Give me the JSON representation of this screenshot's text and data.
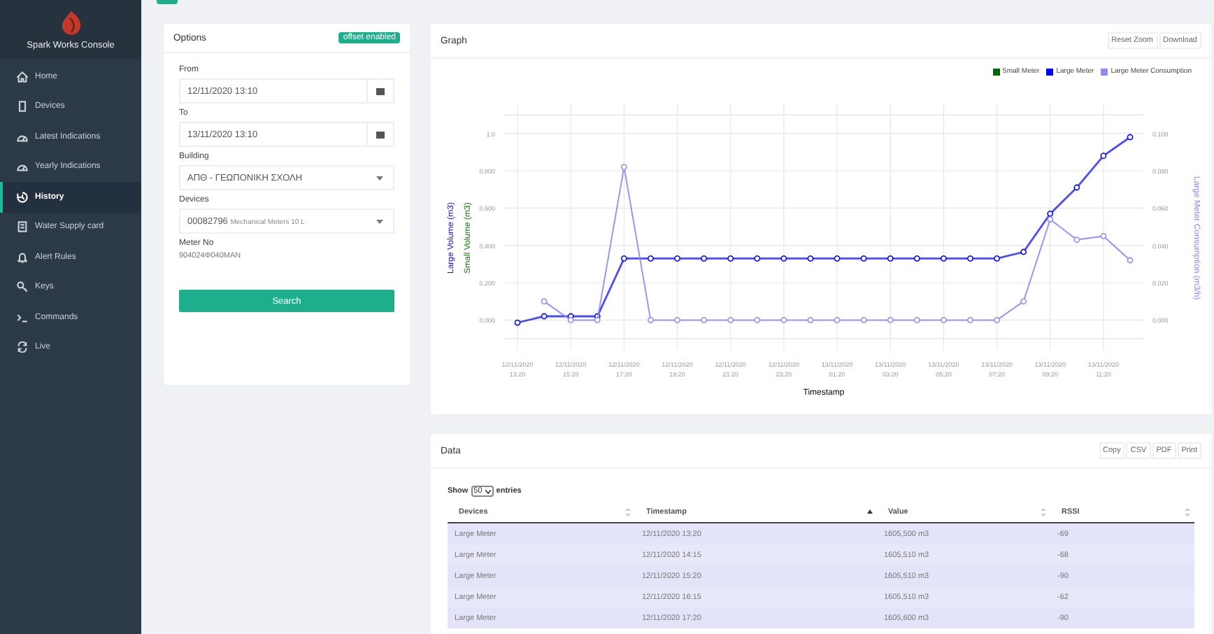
{
  "sidebar": {
    "app_title": "Spark Works Console",
    "items": [
      {
        "label": "Home",
        "selected": false
      },
      {
        "label": "Devices",
        "selected": false
      },
      {
        "label": "Latest Indications",
        "selected": false
      },
      {
        "label": "Yearly Indications",
        "selected": false
      },
      {
        "label": "History",
        "selected": true
      },
      {
        "label": "Water Supply card",
        "selected": false
      },
      {
        "label": "Alert Rules",
        "selected": false
      },
      {
        "label": "Keys",
        "selected": false
      },
      {
        "label": "Commands",
        "selected": false
      },
      {
        "label": "Live",
        "selected": false
      }
    ]
  },
  "options": {
    "title": "Options",
    "badge": "offset enabled",
    "from": {
      "label": "From",
      "value": "12/11/2020 13:10"
    },
    "to": {
      "label": "To",
      "value": "13/11/2020 13:10"
    },
    "building": {
      "label": "Building",
      "value": "ΑΠΘ - ΓΕΩΠΟΝΙΚΗ ΣΧΟΛΗ"
    },
    "devices": {
      "label": "Devices",
      "value": "00082796",
      "detail": "Mechanical Meters 10 L"
    },
    "meter_no": {
      "label": "Meter No",
      "value": "904024Φ040MAN"
    },
    "search_button": "Search"
  },
  "graph": {
    "title": "Graph",
    "buttons": [
      "Reset Zoom",
      "Download"
    ],
    "chart_data": {
      "type": "line",
      "xlabel": "Timestamp",
      "ylabel": "Small Volume (m3)",
      "y3label": "Large Volume (m3)",
      "y2label": "Large Meter Consumption (m3/h)",
      "categories": [
        "12/11/2020 13:20",
        null,
        "12/11/2020 15:20",
        null,
        "12/11/2020 17:20",
        null,
        "12/11/2020 19:20",
        null,
        "12/11/2020 21:20",
        null,
        "12/11/2020 23:20",
        null,
        "13/11/2020 01:20",
        null,
        "13/11/2020 03:20",
        null,
        "13/11/2020 05:20",
        null,
        "13/11/2020 07:20",
        null,
        "13/11/2020 09:20",
        null,
        "13/11/2020 11:20",
        null
      ],
      "ylim": [
        -0.1,
        1.1
      ],
      "yticks": [
        {
          "value": 0,
          "label": "0.000"
        },
        {
          "value": 0.2,
          "label": "0.200"
        },
        {
          "value": 0.4,
          "label": "0.400"
        },
        {
          "value": 0.6,
          "label": "0.600"
        },
        {
          "value": 0.8,
          "label": "0.800"
        },
        {
          "value": 1,
          "label": "1.0"
        }
      ],
      "y2lim": [
        -0.01,
        0.11
      ],
      "grid": true,
      "legend": "top-right",
      "y2ticks": [
        {
          "value": 0,
          "label": "0.000"
        },
        {
          "value": 0.02,
          "label": "0.020"
        },
        {
          "value": 0.04,
          "label": "0.040"
        },
        {
          "value": 0.06,
          "label": "0.060"
        },
        {
          "value": 0.08,
          "label": "0.080"
        },
        {
          "value": 0.1,
          "label": "0.100"
        }
      ],
      "series": [
        {
          "name": "Small Meter",
          "color": "#006400",
          "values": [
            null,
            null,
            null,
            null,
            null,
            null,
            null,
            null,
            null,
            null,
            null,
            null,
            null,
            null,
            null,
            null,
            null,
            null,
            null,
            null,
            null,
            null,
            null,
            null
          ]
        },
        {
          "name": "Large Meter",
          "color": "#0000ff",
          "marker": "circle",
          "values": [
            -0.014,
            0.02,
            0.02,
            0.02,
            0.33,
            0.33,
            0.33,
            0.33,
            0.33,
            0.33,
            0.33,
            0.33,
            0.33,
            0.33,
            0.33,
            0.33,
            0.33,
            0.33,
            0.33,
            0.365,
            0.57,
            0.71,
            0.88,
            0.98
          ]
        },
        {
          "name": "Large Meter Consumption",
          "color": "#8c8cf5",
          "axis": "y2",
          "marker": "circle",
          "values": [
            null,
            0.01,
            0,
            0,
            0.082,
            0,
            0,
            0,
            0,
            0,
            0,
            0,
            0,
            0,
            0,
            0,
            0,
            0,
            0,
            0.01,
            0.054,
            0.043,
            0.045,
            0.032
          ]
        }
      ]
    }
  },
  "data": {
    "title": "Data",
    "buttons": [
      "Copy",
      "CSV",
      "PDF",
      "Print"
    ],
    "show_label": "Show",
    "page_size": "50",
    "entries_label": "entries",
    "columns": [
      {
        "label": "Devices",
        "sorted": false
      },
      {
        "label": "Timestamp",
        "sorted": true
      },
      {
        "label": "Value",
        "sorted": false
      },
      {
        "label": "RSSI",
        "sorted": false
      }
    ],
    "rows": [
      [
        "Large Meter",
        "12/11/2020 13:20",
        "1605,500 m3",
        "-69"
      ],
      [
        "Large Meter",
        "12/11/2020 14:15",
        "1605,510 m3",
        "-68"
      ],
      [
        "Large Meter",
        "12/11/2020 15:20",
        "1605,510 m3",
        "-90"
      ],
      [
        "Large Meter",
        "12/11/2020 16:15",
        "1605,510 m3",
        "-62"
      ],
      [
        "Large Meter",
        "12/11/2020 17:20",
        "1605,600 m3",
        "-90"
      ]
    ]
  }
}
